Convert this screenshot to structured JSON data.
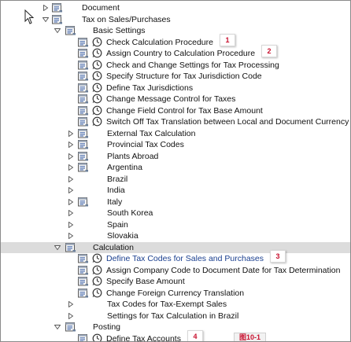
{
  "tree": [
    {
      "label": "Document",
      "level": 0,
      "expanded": false,
      "folder": true
    },
    {
      "label": "Tax on Sales/Purchases",
      "level": 0,
      "expanded": true,
      "folder": true
    },
    {
      "label": "Basic Settings",
      "level": 1,
      "expanded": true,
      "folder": true
    },
    {
      "label": "Check Calculation Procedure",
      "level": 2,
      "exec": true,
      "badge": "1"
    },
    {
      "label": "Assign Country to Calculation Procedure",
      "level": 2,
      "exec": true,
      "badge": "2"
    },
    {
      "label": "Check and Change Settings for Tax Processing",
      "level": 2,
      "exec": true
    },
    {
      "label": "Specify Structure for Tax Jurisdiction Code",
      "level": 2,
      "exec": true
    },
    {
      "label": "Define Tax Jurisdictions",
      "level": 2,
      "exec": true
    },
    {
      "label": "Change Message Control for Taxes",
      "level": 2,
      "exec": true
    },
    {
      "label": "Change Field Control for Tax Base Amount",
      "level": 2,
      "exec": true
    },
    {
      "label": "Switch Off Tax Translation between Local and Document Currency",
      "level": 2,
      "exec": true
    },
    {
      "label": "External Tax Calculation",
      "level": 2,
      "expanded": false,
      "folder": true
    },
    {
      "label": "Provincial Tax Codes",
      "level": 2,
      "expanded": false,
      "folder": true
    },
    {
      "label": "Plants Abroad",
      "level": 2,
      "expanded": false,
      "folder": true
    },
    {
      "label": "Argentina",
      "level": 2,
      "expanded": false,
      "folder": true
    },
    {
      "label": "Brazil",
      "level": 2,
      "expanded": false
    },
    {
      "label": "India",
      "level": 2,
      "expanded": false
    },
    {
      "label": "Italy",
      "level": 2,
      "expanded": false,
      "folder": true
    },
    {
      "label": "South Korea",
      "level": 2,
      "expanded": false
    },
    {
      "label": "Spain",
      "level": 2,
      "expanded": false
    },
    {
      "label": "Slovakia",
      "level": 2,
      "expanded": false
    },
    {
      "label": "Calculation",
      "level": 1,
      "expanded": true,
      "folder": true,
      "selected": true
    },
    {
      "label": "Define Tax Codes for Sales and Purchases",
      "level": 2,
      "exec": true,
      "link": true,
      "badge": "3"
    },
    {
      "label": "Assign Company Code to Document Date for Tax Determination",
      "level": 2,
      "exec": true
    },
    {
      "label": "Specify Base Amount",
      "level": 2,
      "exec": true
    },
    {
      "label": "Change Foreign Currency Translation",
      "level": 2,
      "exec": true
    },
    {
      "label": "Tax Codes for Tax-Exempt Sales",
      "level": 2,
      "expanded": false
    },
    {
      "label": "Settings for Tax Calculation in Brazil",
      "level": 2,
      "expanded": false
    },
    {
      "label": "Posting",
      "level": 1,
      "expanded": true,
      "folder": true
    },
    {
      "label": "Define Tax Accounts",
      "level": 2,
      "exec": true,
      "badge": "4"
    }
  ],
  "figure_label": "图10-1",
  "colors": {
    "badge": "#c8102e",
    "link": "#1a3f8f",
    "selected_row": "#dcdcdc"
  }
}
